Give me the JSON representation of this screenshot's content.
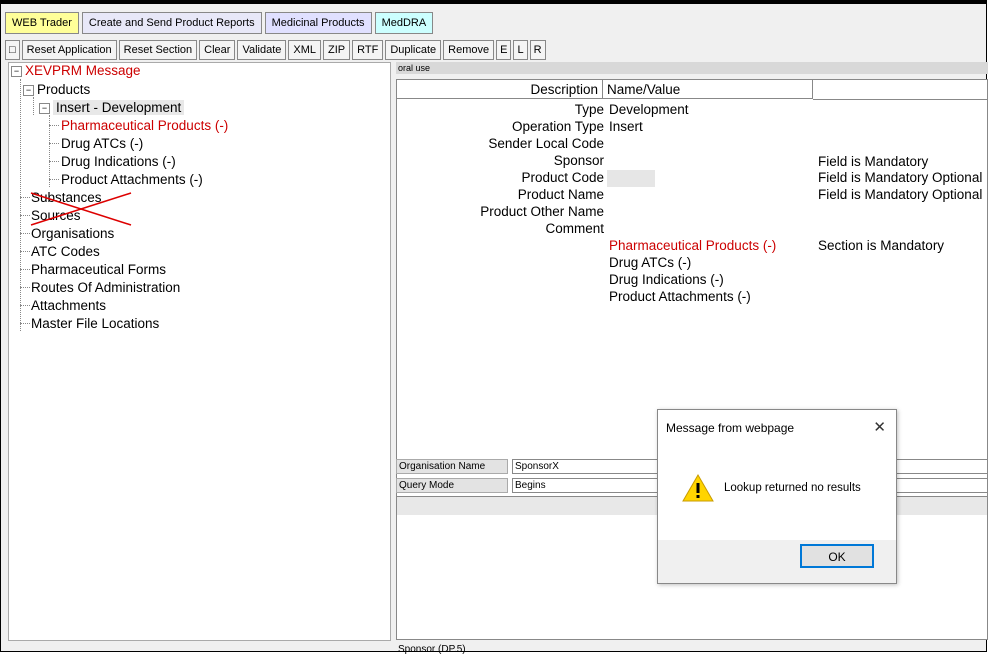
{
  "tabs": [
    "WEB Trader",
    "Create and Send Product Reports",
    "Medicinal Products",
    "MedDRA"
  ],
  "toolbar": {
    "square_icon": "□",
    "buttons": [
      "Reset Application",
      "Reset Section",
      "Clear",
      "Validate",
      "XML",
      "ZIP",
      "RTF",
      "Duplicate",
      "Remove",
      "E",
      "L",
      "R"
    ]
  },
  "tree": {
    "root": "XEVPRM Message",
    "products": "Products",
    "insert": "Insert - Development",
    "pharma": "Pharmaceutical Products (-)",
    "drug_atcs": "Drug ATCs (-)",
    "drug_ind": "Drug Indications (-)",
    "prod_att": "Product Attachments (-)",
    "substances": "Substances",
    "sources": "Sources",
    "organisations": "Organisations",
    "atc_codes": "ATC Codes",
    "pharm_forms": "Pharmaceutical Forms",
    "routes": "Routes Of Administration",
    "attachments": "Attachments",
    "master_file": "Master File Locations",
    "expander_minus": "−"
  },
  "section_bar": "oral use",
  "grid": {
    "col_desc": "Description",
    "col_value": "Name/Value",
    "rows": [
      {
        "desc": "Type",
        "value": "Development",
        "note": ""
      },
      {
        "desc": "Operation Type",
        "value": "Insert",
        "note": ""
      },
      {
        "desc": "Sender Local Code",
        "value": "",
        "note": ""
      },
      {
        "desc": "Sponsor",
        "value": "",
        "note": "Field is Mandatory"
      },
      {
        "desc": "Product Code",
        "value": "",
        "note": "Field is Mandatory Optional"
      },
      {
        "desc": "Product Name",
        "value": "",
        "note": "Field is Mandatory Optional"
      },
      {
        "desc": "Product Other Name",
        "value": "",
        "note": ""
      },
      {
        "desc": "Comment",
        "value": "",
        "note": ""
      }
    ],
    "sections": [
      {
        "label": "Pharmaceutical Products (-)",
        "note": "Section is Mandatory"
      },
      {
        "label": "Drug ATCs (-)",
        "note": ""
      },
      {
        "label": "Drug Indications (-)",
        "note": ""
      },
      {
        "label": "Product Attachments (-)",
        "note": ""
      }
    ]
  },
  "query": {
    "org_label": "Organisation Name",
    "org_value": "SponsorX",
    "mode_label": "Query Mode",
    "mode_value": "Begins"
  },
  "footer": "Sponsor (DP.5)",
  "dialog": {
    "title": "Message from webpage",
    "close": "✕",
    "message": "Lookup returned no results",
    "ok": "OK"
  }
}
